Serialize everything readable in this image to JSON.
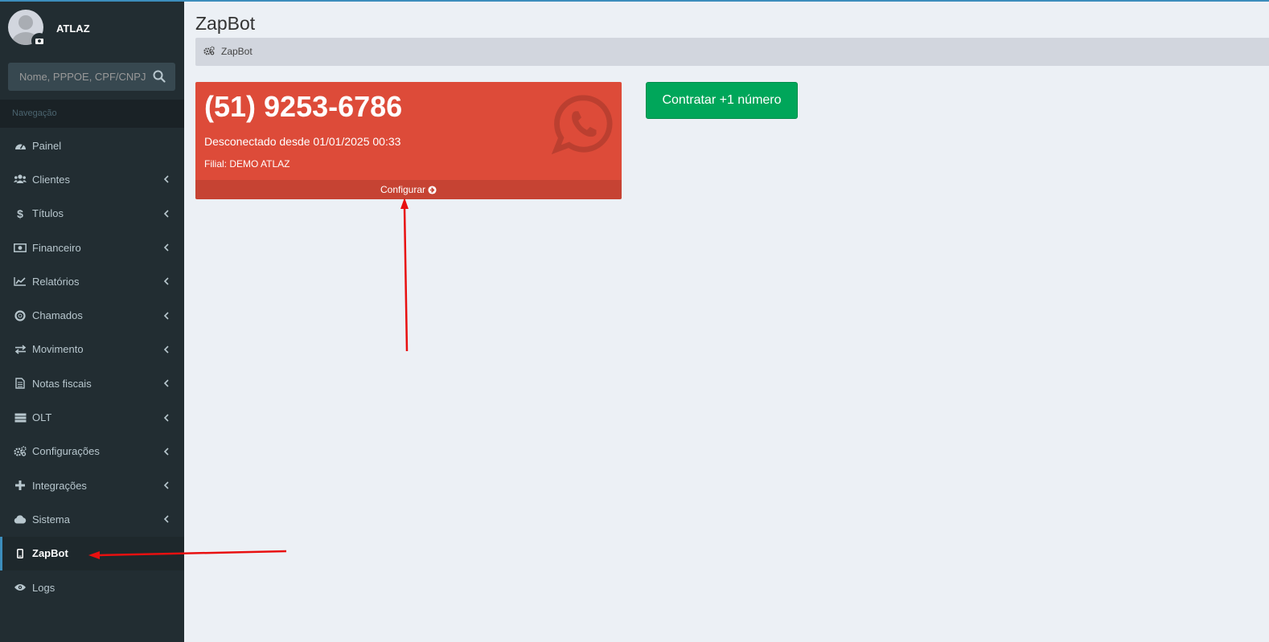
{
  "user": {
    "name": "ATLAZ"
  },
  "search": {
    "placeholder": "Nome, PPPOE, CPF/CNPJ"
  },
  "nav": {
    "header": "Navegação",
    "items": [
      {
        "label": "Painel",
        "icon": "dashboard-icon"
      },
      {
        "label": "Clientes",
        "icon": "users-icon"
      },
      {
        "label": "Títulos",
        "icon": "dollar-icon"
      },
      {
        "label": "Financeiro",
        "icon": "money-icon"
      },
      {
        "label": "Relatórios",
        "icon": "line-chart-icon"
      },
      {
        "label": "Chamados",
        "icon": "lifebuoy-icon"
      },
      {
        "label": "Movimento",
        "icon": "exchange-icon"
      },
      {
        "label": "Notas fiscais",
        "icon": "file-text-icon"
      },
      {
        "label": "OLT",
        "icon": "server-icon"
      },
      {
        "label": "Configurações",
        "icon": "cogs-icon"
      },
      {
        "label": "Integrações",
        "icon": "plus-icon"
      },
      {
        "label": "Sistema",
        "icon": "cloud-icon"
      },
      {
        "label": "ZapBot",
        "icon": "mobile-icon"
      },
      {
        "label": "Logs",
        "icon": "eye-icon"
      }
    ]
  },
  "page": {
    "title": "ZapBot",
    "breadcrumb": "ZapBot"
  },
  "card": {
    "phone": "(51) 9253-6786",
    "status": "Desconectado desde 01/01/2025 00:33",
    "branch": "Filial: DEMO ATLAZ",
    "footer_label": "Configurar",
    "color": "#dd4b39"
  },
  "actions": {
    "contract_label": "Contratar +1 número"
  },
  "colors": {
    "sidebar": "#222d32",
    "accent": "#3c8dbc",
    "success": "#00a65a",
    "danger": "#dd4b39"
  }
}
